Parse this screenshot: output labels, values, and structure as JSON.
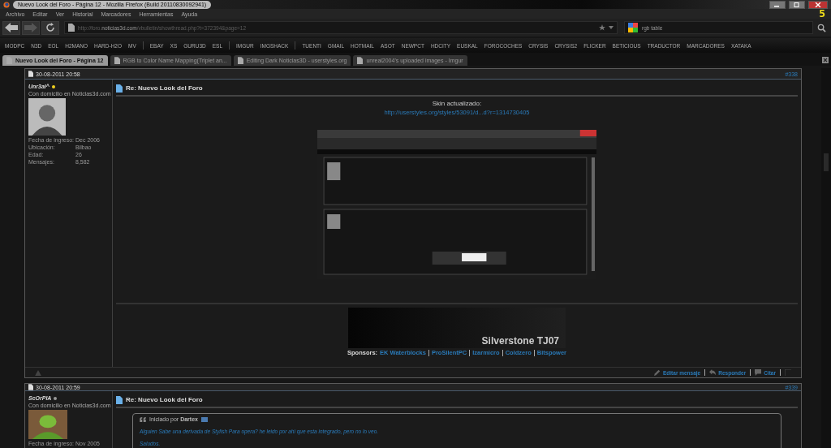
{
  "window": {
    "title": "Nuevo Look del Foro - Página 12 - Mozilla Firefox (Build 20110830092941)",
    "counter": "5"
  },
  "menu": [
    "Archivo",
    "Editar",
    "Ver",
    "Historial",
    "Marcadores",
    "Herramientas",
    "Ayuda"
  ],
  "address": {
    "prefix": "http://foro.",
    "domain": "noticias3d.com",
    "path": "/vbulletin/showthread.php?t=372394&page=12"
  },
  "search": {
    "value": "rgb table"
  },
  "bookmarks": [
    [
      "MODPC",
      "N3D",
      "EOL",
      "H2MANO",
      "HARD-H2O",
      "MV"
    ],
    [
      "EBAY",
      "XS",
      "GURU3D",
      "ESL"
    ],
    [
      "IMGUR",
      "IMGSHACK"
    ],
    [
      "TUENTI",
      "GMAIL",
      "HOTMAIL",
      "ASOT",
      "NEWPCT",
      "HDCITY",
      "EUSKAL",
      "FOROCOCHES",
      "CRYSIS",
      "CRYSIS2",
      "FLICKER",
      "BETICIOUS",
      "TRADUCTOR",
      "MARCADORES",
      "XATAKA"
    ]
  ],
  "tabs": [
    {
      "label": "Nuevo Look del Foro - Página 12",
      "selected": true
    },
    {
      "label": "RGB to Color Name Mapping(Triplet an...",
      "selected": false
    },
    {
      "label": "Editing Dark Noticias3D - userstyles.org",
      "selected": false
    },
    {
      "label": "unreal2004's uploaded images - Imgur",
      "selected": false
    }
  ],
  "posts": [
    {
      "date": "30-08-2011 20:58",
      "number": "#338",
      "user": {
        "name": "Unr3al^",
        "online": true,
        "title": "Con domicilio en Noticias3d.com",
        "fields": [
          {
            "label": "Fecha de ingreso:",
            "value": "Dec 2006"
          },
          {
            "label": "Ubicación:",
            "value": "Bilbao"
          },
          {
            "label": "Edad:",
            "value": "26"
          },
          {
            "label": "Mensajes:",
            "value": "8,582"
          }
        ]
      },
      "title": "Re: Nuevo Look del Foro",
      "heading": "Skin actualizado:",
      "link": "http://userstyles.org/styles/53091/d...d?r=1314730405",
      "signature": {
        "banner": "Silverstone TJ07",
        "label": "Sponsors:",
        "sponsors": [
          "EK Waterblocks",
          "ProSilentPC",
          "Izarmicro",
          "Coldzero",
          "Bitspower"
        ]
      },
      "actions": [
        "Editar mensaje",
        "Responder",
        "Citar"
      ]
    },
    {
      "date": "30-08-2011 20:59",
      "number": "#339",
      "user": {
        "name": "ScOrPIA",
        "online": false,
        "title": "Con domicilio en Noticias3d.com",
        "fields": [
          {
            "label": "Fecha de ingreso:",
            "value": "Nov 2005"
          }
        ]
      },
      "title": "Re: Nuevo Look del Foro",
      "quote": {
        "prefix": "Iniciado por",
        "author": "Dartex",
        "lines": [
          "Alguien Sabe una derivada de Stylish Para opera? he leido por ahi que esta integrado, pero no lo veo.",
          "Saludos."
        ]
      }
    }
  ]
}
